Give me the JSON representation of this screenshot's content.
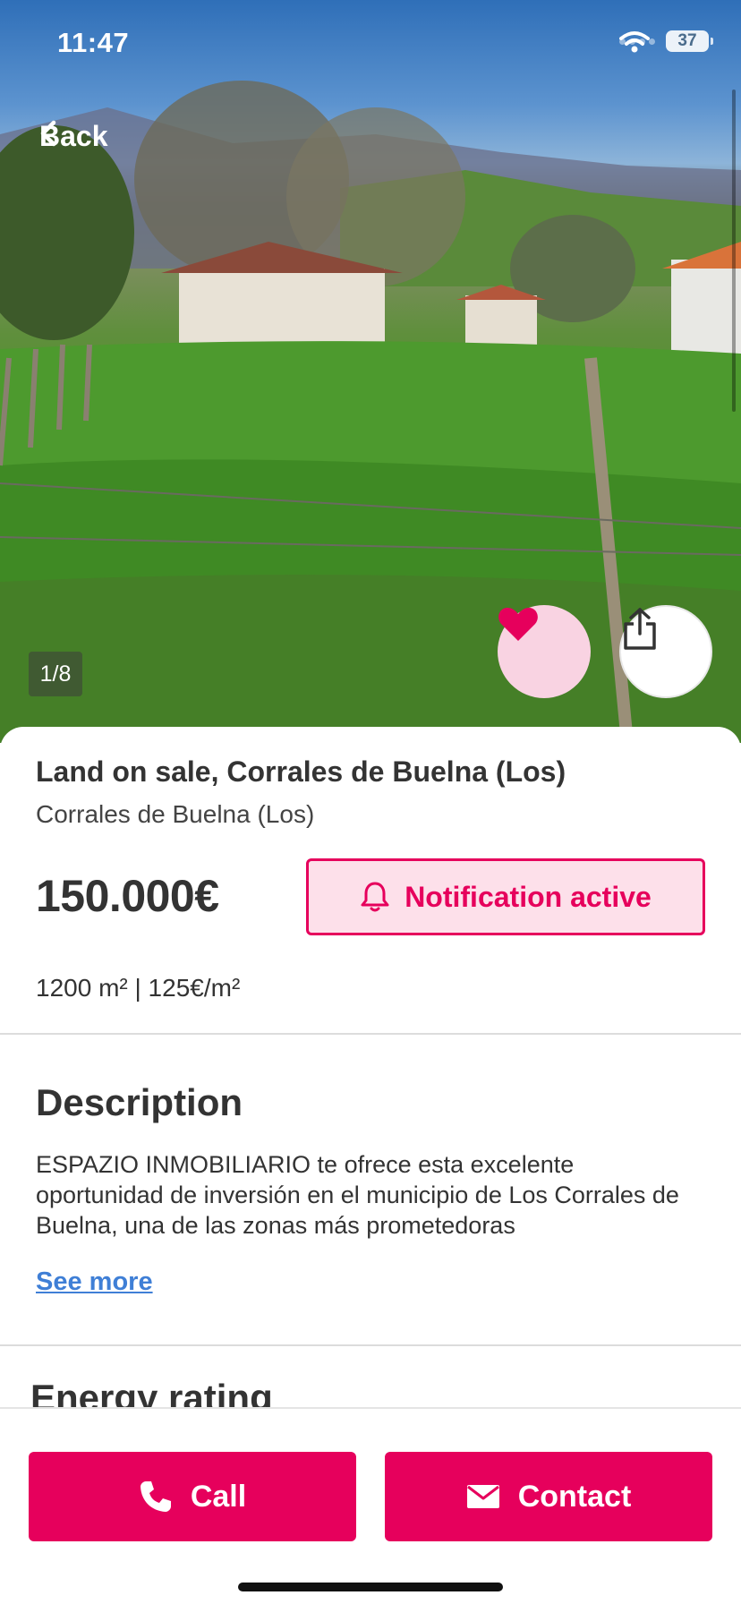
{
  "status_bar": {
    "time": "11:47",
    "battery": "37"
  },
  "nav": {
    "back_label": "Back"
  },
  "gallery": {
    "counter": "1/8",
    "favorite_icon": "heart-icon",
    "share_icon": "share-icon",
    "favorited": true
  },
  "listing": {
    "title": "Land on sale, Corrales de Buelna (Los)",
    "location": "Corrales de Buelna (Los)",
    "price": "150.000€",
    "notification_label": "Notification active",
    "specs": "1200 m² | 125€/m²"
  },
  "description": {
    "heading": "Description",
    "text": "ESPAZIO INMOBILIARIO te ofrece esta excelente oportunidad de inversión en el municipio de Los Corrales de Buelna, una de las zonas más prometedoras",
    "see_more_label": "See more"
  },
  "energy": {
    "heading": "Energy rating"
  },
  "actions": {
    "call_label": "Call",
    "contact_label": "Contact"
  },
  "colors": {
    "accent": "#e6005c",
    "accent_light": "#fde0ea",
    "link": "#3f7fd6"
  }
}
